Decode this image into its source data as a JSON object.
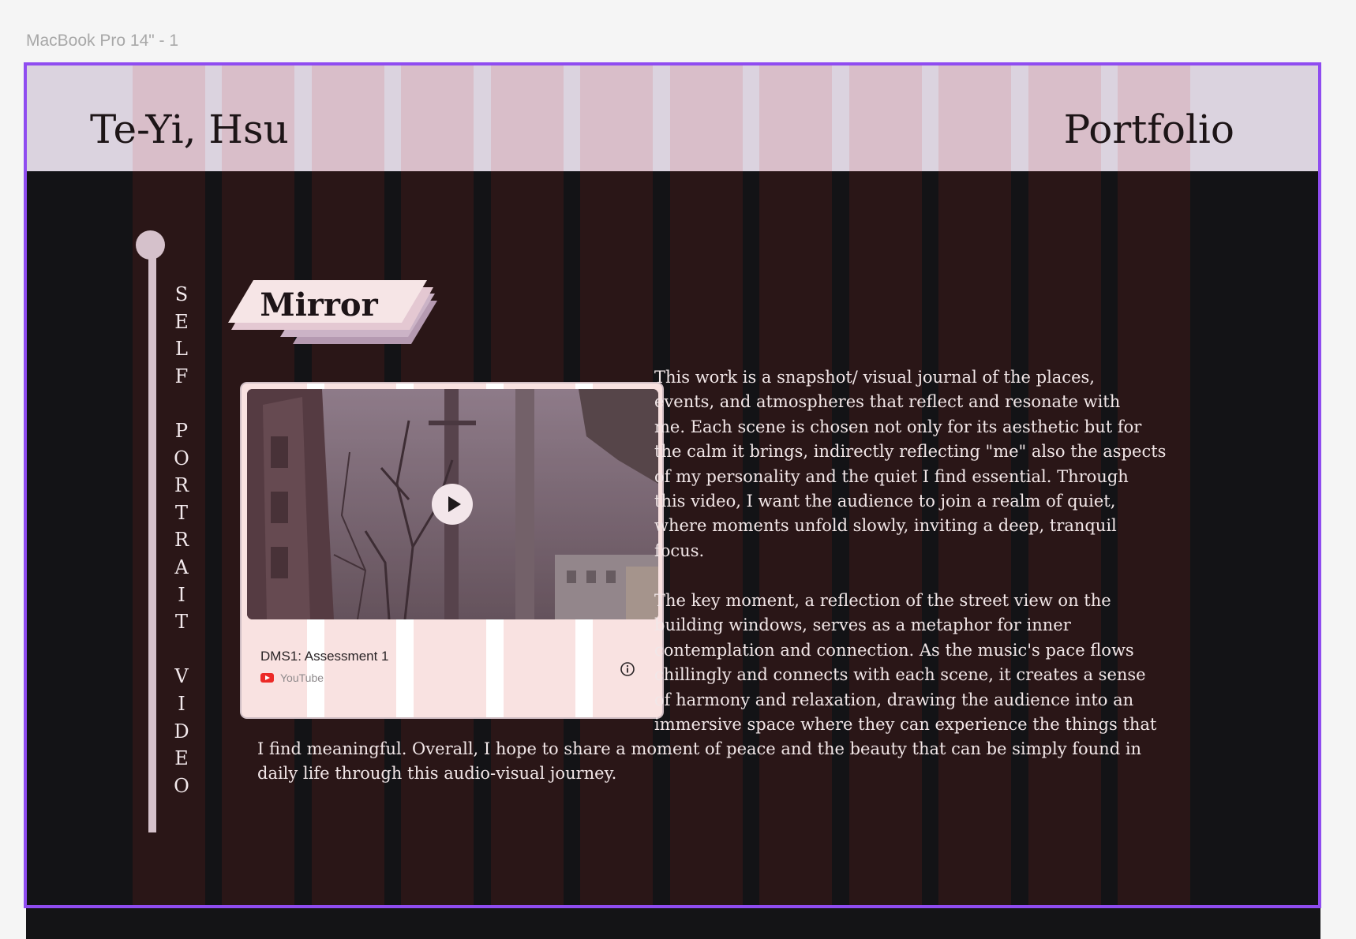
{
  "frame_label": "MacBook Pro 14\" - 1",
  "header": {
    "name": "Te-Yi, Hsu",
    "portfolio": "Portfolio"
  },
  "sidebar": {
    "vertical_label": "S\nE\nL\nF\n\nP\nO\nR\nT\nR\nA\nI\nT\n\nV\nI\nD\nE\nO"
  },
  "section": {
    "title": "Mirror"
  },
  "video_card": {
    "title": "DMS1: Assessment 1",
    "source": "YouTube",
    "play_icon": "play-icon",
    "info_icon": "info-icon"
  },
  "description": {
    "paragraph1_lines": [
      "This work is a snapshot/ visual journal of the places,",
      "events, and atmospheres that reflect and resonate with",
      "me. Each scene is chosen not only for its aesthetic but for",
      "the calm it brings, indirectly reflecting \"me\" also the aspects",
      "of my personality and the quiet I find essential. Through",
      "this video, I want the audience to join a realm of quiet,",
      "where moments unfold slowly, inviting a deep, tranquil",
      "focus."
    ],
    "paragraph2_lines": [
      "The key moment, a reflection of the street view on the",
      "building windows, serves as a metaphor for inner",
      "contemplation and connection. As the music's pace flows",
      "chillingly and connects with each scene, it creates a sense",
      "of harmony and relaxation, drawing the audience into an",
      "immersive space where they can experience the things that"
    ],
    "paragraph2_continued_lines": [
      "I find meaningful. Overall, I hope to share a moment of peace and the beauty that can be simply found in",
      "daily life through this audio-visual journey."
    ]
  },
  "colors": {
    "frame_border": "#8f4cf0",
    "header_bg": "#dbd3df",
    "body_bg": "#131316",
    "column_dark": "#2a1617",
    "column_light": "#d9bec9",
    "accent_pink": "#f9e2e1"
  }
}
